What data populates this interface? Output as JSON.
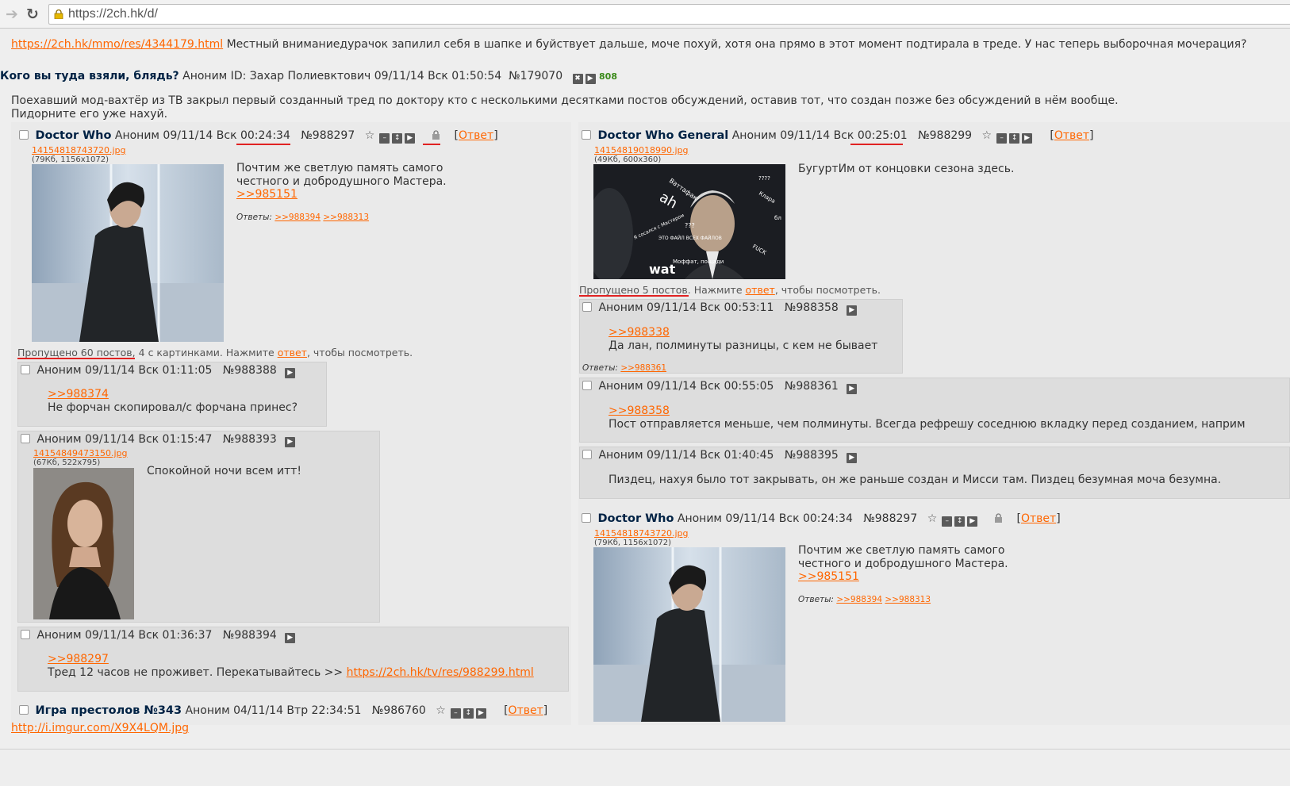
{
  "browser": {
    "url": "https://2ch.hk/d/"
  },
  "topline": {
    "link": "https://2ch.hk/mmo/res/4344179.html",
    "text": "Местный вниманиедурачок запилил себя в шапке и буйствует дальше, моче похуй, хотя она прямо в этот момент подтирала в треде. У нас теперь выборочная мочерация?"
  },
  "op": {
    "subject": "Кого вы туда взяли, блядь?",
    "meta": "Аноним ID: Захар Полиевктович 09/11/14 Вск 01:50:54",
    "num": "№179070",
    "count": "808",
    "text_line1": "Поехавший мод-вахтёр из ТВ закрыл первый созданный тред по доктору кто с несколькими десятками постов обсуждений, оставив тот, что создан позже без обсуждений в нём вообще.",
    "text_line2": "Пидорните его уже нахуй."
  },
  "reply_label": "Ответ",
  "replies_label": "Ответы:",
  "left": {
    "thread": {
      "subject": "Doctor Who",
      "meta": "Аноним 09/11/14 Вск",
      "time": "00:24:34",
      "num": "№988297",
      "file": "14154818743720.jpg",
      "file_info": "(79Кб, 1156x1072)",
      "text_1": "Почтим же светлую память самого",
      "text_2": "честного и добродушного Мастера.",
      "link": ">>985151",
      "reply_links": [
        ">>988394",
        ">>988313"
      ]
    },
    "omitted": {
      "part1": "Пропущено 60 постов,",
      "part2": "4 с картинками. Нажмите",
      "link": "ответ",
      "part3": ", чтобы посмотреть."
    },
    "posts": [
      {
        "meta": "Аноним 09/11/14 Вск 01:11:05",
        "num": "№988388",
        "link": ">>988374",
        "text": "Не форчан скопировал/с форчана принес?"
      },
      {
        "meta": "Аноним 09/11/14 Вск 01:15:47",
        "num": "№988393",
        "file": "14154849473150.jpg",
        "file_info": "(67Кб, 522x795)",
        "text": "Спокойной ночи всем итт!"
      },
      {
        "meta": "Аноним 09/11/14 Вск 01:36:37",
        "num": "№988394",
        "link": ">>988297",
        "text": "Тред 12 часов не проживет. Перекатывайтесь >>",
        "url": "https://2ch.hk/tv/res/988299.html"
      }
    ],
    "thread2": {
      "subject": "Игра престолов №343",
      "meta": "Аноним 04/11/14 Втр 22:34:51",
      "num": "№986760"
    },
    "bottom_link": "http://i.imgur.com/X9X4LQM.jpg"
  },
  "right": {
    "thread": {
      "subject": "Doctor Who General",
      "meta": "Аноним 09/11/14 Вск",
      "time": "00:25:01",
      "num": "№988299",
      "file": "14154819018990.jpg",
      "file_info": "(49Кб, 600x360)",
      "text": "БугуртИм от концовки сезона здесь."
    },
    "meme_words": [
      "ah",
      "Ваттафак",
      "Клара",
      "wat",
      "Моффат, пощади",
      "ЭТО ФАЙЛ ВСЕХ ФАЙЛОВ",
      "Я сосался с Мастером",
      "FUCK",
      "????",
      "???",
      "бл"
    ],
    "omitted": {
      "part1": "Пропущено 5 постов.",
      "part2": "Нажмите",
      "link": "ответ",
      "part3": ", чтобы посмотреть."
    },
    "posts": [
      {
        "meta": "Аноним 09/11/14 Вск 00:53:11",
        "num": "№988358",
        "link": ">>988338",
        "text": "Да лан, полминуты разницы, с кем не бывает",
        "reply_links": [
          ">>988361"
        ]
      },
      {
        "meta": "Аноним 09/11/14 Вск 00:55:05",
        "num": "№988361",
        "link": ">>988358",
        "text": "Пост отправляется меньше, чем полминуты. Всегда рефрешу соседнюю вкладку перед созданием, наприм"
      },
      {
        "meta": "Аноним 09/11/14 Вск 01:40:45",
        "num": "№988395",
        "text": "Пиздец, нахуя было тот закрывать, он же раньше создан и Мисси там. Пиздец безумная моча безумна."
      }
    ],
    "thread2": {
      "subject": "Doctor Who",
      "meta": "Аноним 09/11/14 Вск 00:24:34",
      "num": "№988297",
      "file": "14154818743720.jpg",
      "file_info": "(79Кб, 1156x1072)",
      "text_1": "Почтим же светлую память самого",
      "text_2": "честного и добродушного Мастера.",
      "link": ">>985151",
      "reply_links": [
        ">>988394",
        ">>988313"
      ]
    }
  }
}
